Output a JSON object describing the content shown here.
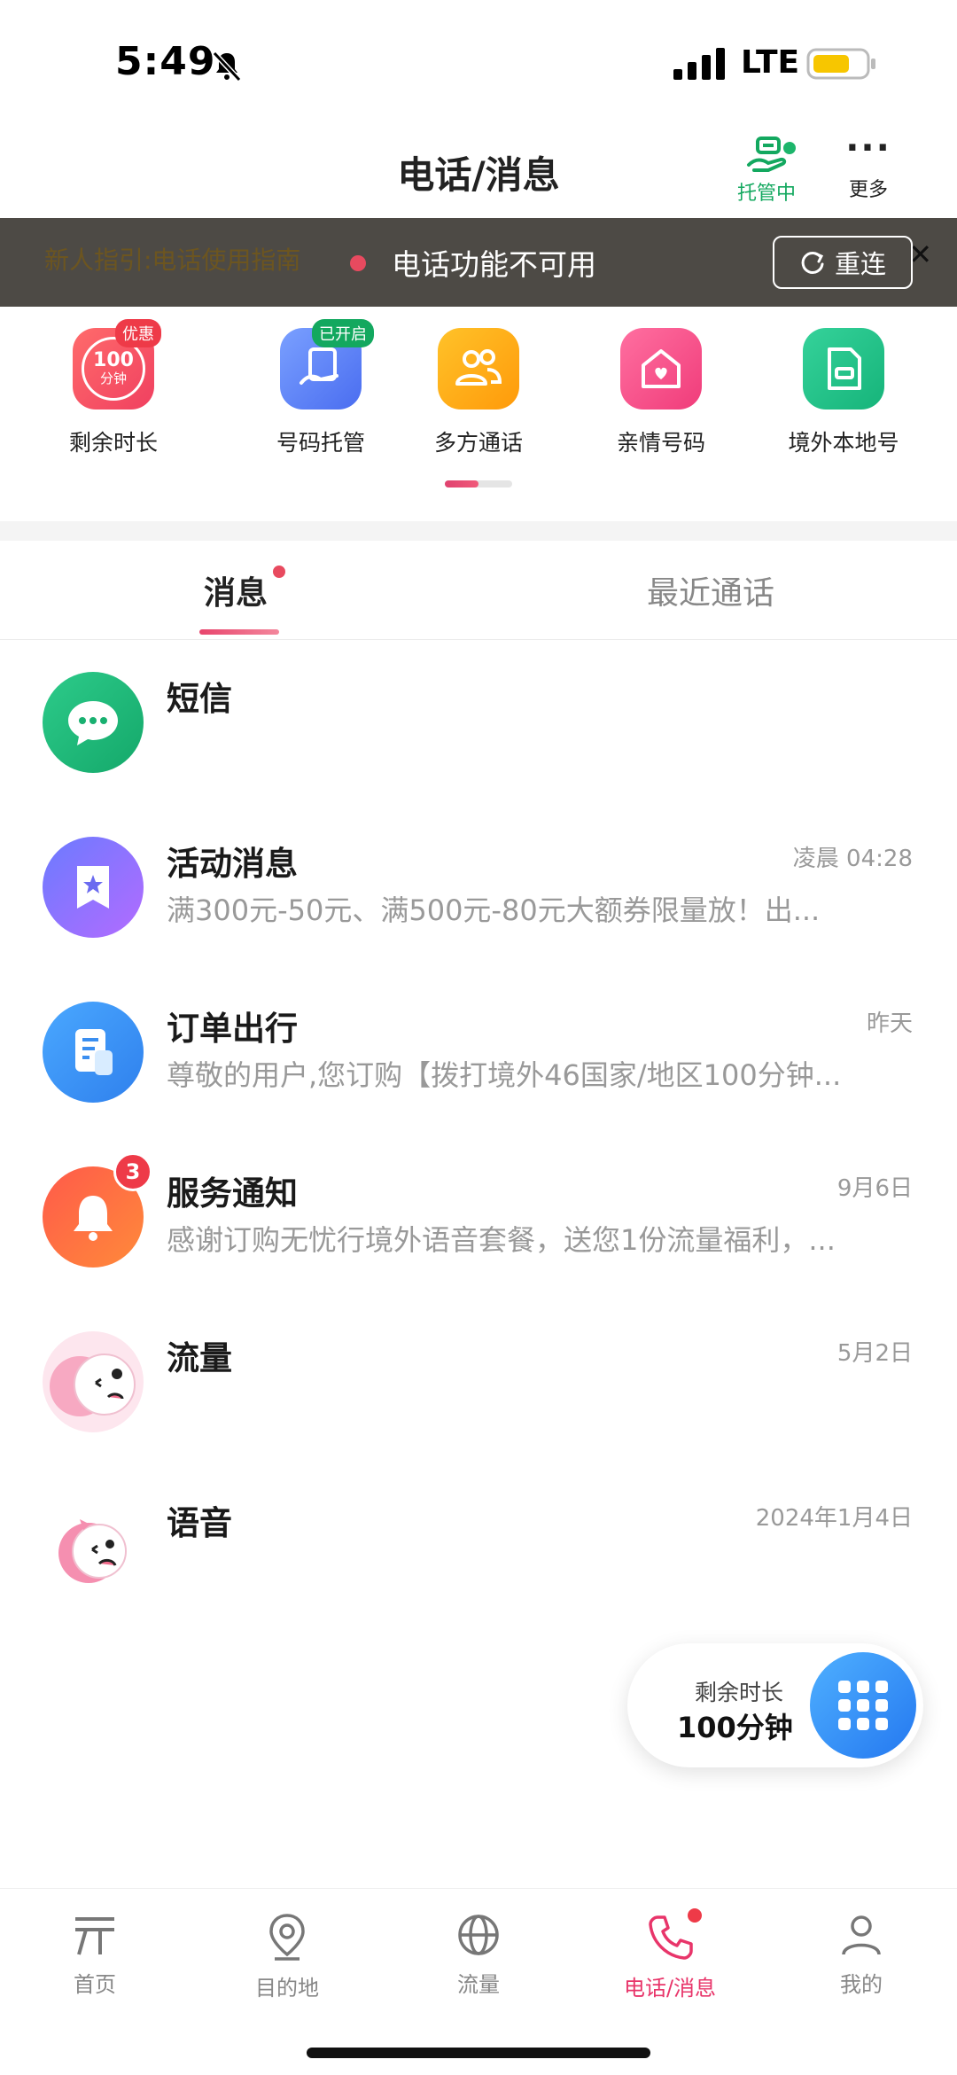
{
  "status_bar": {
    "time": "5:49",
    "network": "LTE"
  },
  "header": {
    "title": "电话/消息",
    "hosting_label": "托管中",
    "more_label": "更多"
  },
  "banner": {
    "guide_text": "新人指引:电话使用指南",
    "status_text": "电话功能不可用",
    "reconnect_label": "重连"
  },
  "quick_actions": [
    {
      "label": "剩余时长",
      "badge": "优惠",
      "icon_line1": "100",
      "icon_line2": "分钟",
      "icon": "timer-icon"
    },
    {
      "label": "号码托管",
      "badge": "已开启",
      "icon": "hosting-phone-icon"
    },
    {
      "label": "多方通话",
      "badge": "",
      "icon": "multi-call-icon"
    },
    {
      "label": "亲情号码",
      "badge": "",
      "icon": "family-number-icon"
    },
    {
      "label": "境外本地号",
      "badge": "",
      "icon": "sim-card-icon"
    }
  ],
  "tabs": {
    "messages": "消息",
    "recent_calls": "最近通话"
  },
  "messages": [
    {
      "title": "短信",
      "time": "",
      "preview": "",
      "badge": ""
    },
    {
      "title": "活动消息",
      "time": "凌晨 04:28",
      "preview": "满300元-50元、满500元-80元大额券限量放！出...",
      "badge": ""
    },
    {
      "title": "订单出行",
      "time": "昨天",
      "preview": "尊敬的用户,您订购【拨打境外46国家/地区100分钟...",
      "badge": ""
    },
    {
      "title": "服务通知",
      "time": "9月6日",
      "preview": "感谢订购无忧行境外语音套餐，送您1份流量福利，...",
      "badge": "3"
    },
    {
      "title": "流量",
      "time": "5月2日",
      "preview": "",
      "badge": ""
    },
    {
      "title": "语音",
      "time": "2024年1月4日",
      "preview": "",
      "badge": ""
    }
  ],
  "floating": {
    "label": "剩余时长",
    "value": "100分钟"
  },
  "bottom_nav": [
    {
      "label": "首页",
      "active": false
    },
    {
      "label": "目的地",
      "active": false
    },
    {
      "label": "流量",
      "active": false
    },
    {
      "label": "电话/消息",
      "active": true
    },
    {
      "label": "我的",
      "active": false
    }
  ],
  "colors": {
    "accent": "#e8356a",
    "green": "#13a85f",
    "banner_bg": "#4d4a45",
    "alert_red": "#ee3a48"
  }
}
